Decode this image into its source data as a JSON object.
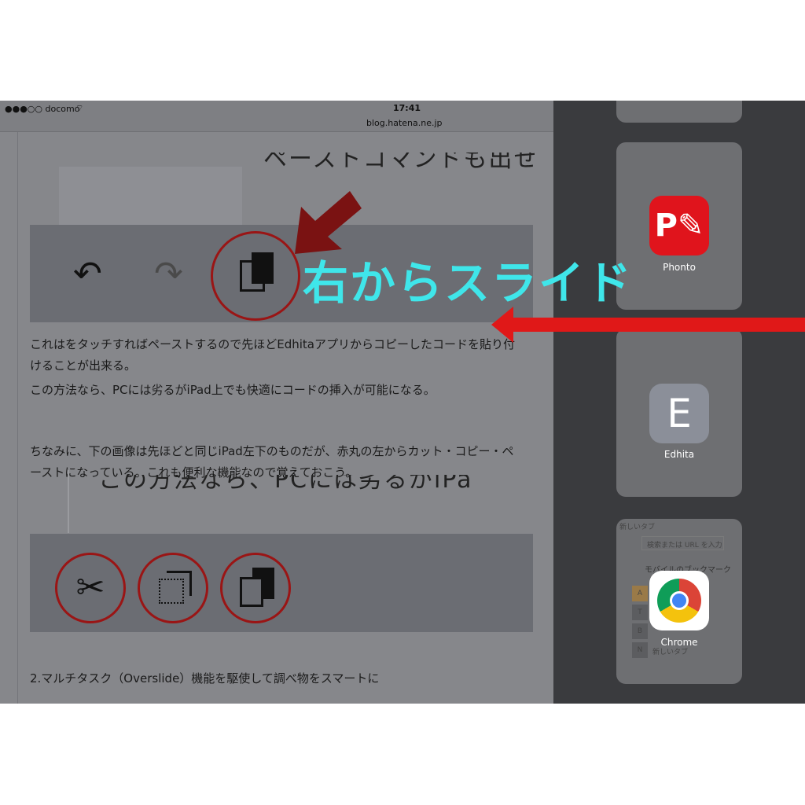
{
  "status": {
    "carrier": "●●●○○ docomo",
    "wifi_icon": "wifi-icon",
    "time": "17:41",
    "url": "blog.hatena.ne.jp"
  },
  "article": {
    "bg_text_top": "ペーストコマンドも出せる",
    "paragraph1": "これはをタッチすればペーストするので先ほどEdhitaアプリからコピーしたコードを貼り付けることが出来る。",
    "paragraph2": "この方法なら、PCには劣るがiPad上でも快適にコードの挿入が可能になる。",
    "paragraph3": "ちなみに、下の画像は先ほどと同じiPad左下のものだが、赤丸の左からカット・コピー・ペーストになっている。これも便利な機能なので覚えておこう。",
    "bg_text_mid": "この方法なら、PCには劣るがiPa",
    "heading2": "2.マルチタスク（Overslide）機能を駆使して調べ物をスマートに"
  },
  "annotation": {
    "slide_label": "右からスライド",
    "accent": "#3fe6ea",
    "arrow_color": "#e01818"
  },
  "apps": [
    {
      "name": "Phonto",
      "color": "#e0141c"
    },
    {
      "name": "Edhita",
      "color": "#8b8f99"
    },
    {
      "name": "Chrome",
      "color": "#ffffff"
    }
  ],
  "chrome_preview": {
    "tab": "新しいタブ",
    "search_placeholder": "検索または URL を入力",
    "bookmarks": "モバイルのブックマーク",
    "items": [
      "A",
      "T",
      "B",
      "N"
    ],
    "item_label": "新しいタブ"
  }
}
